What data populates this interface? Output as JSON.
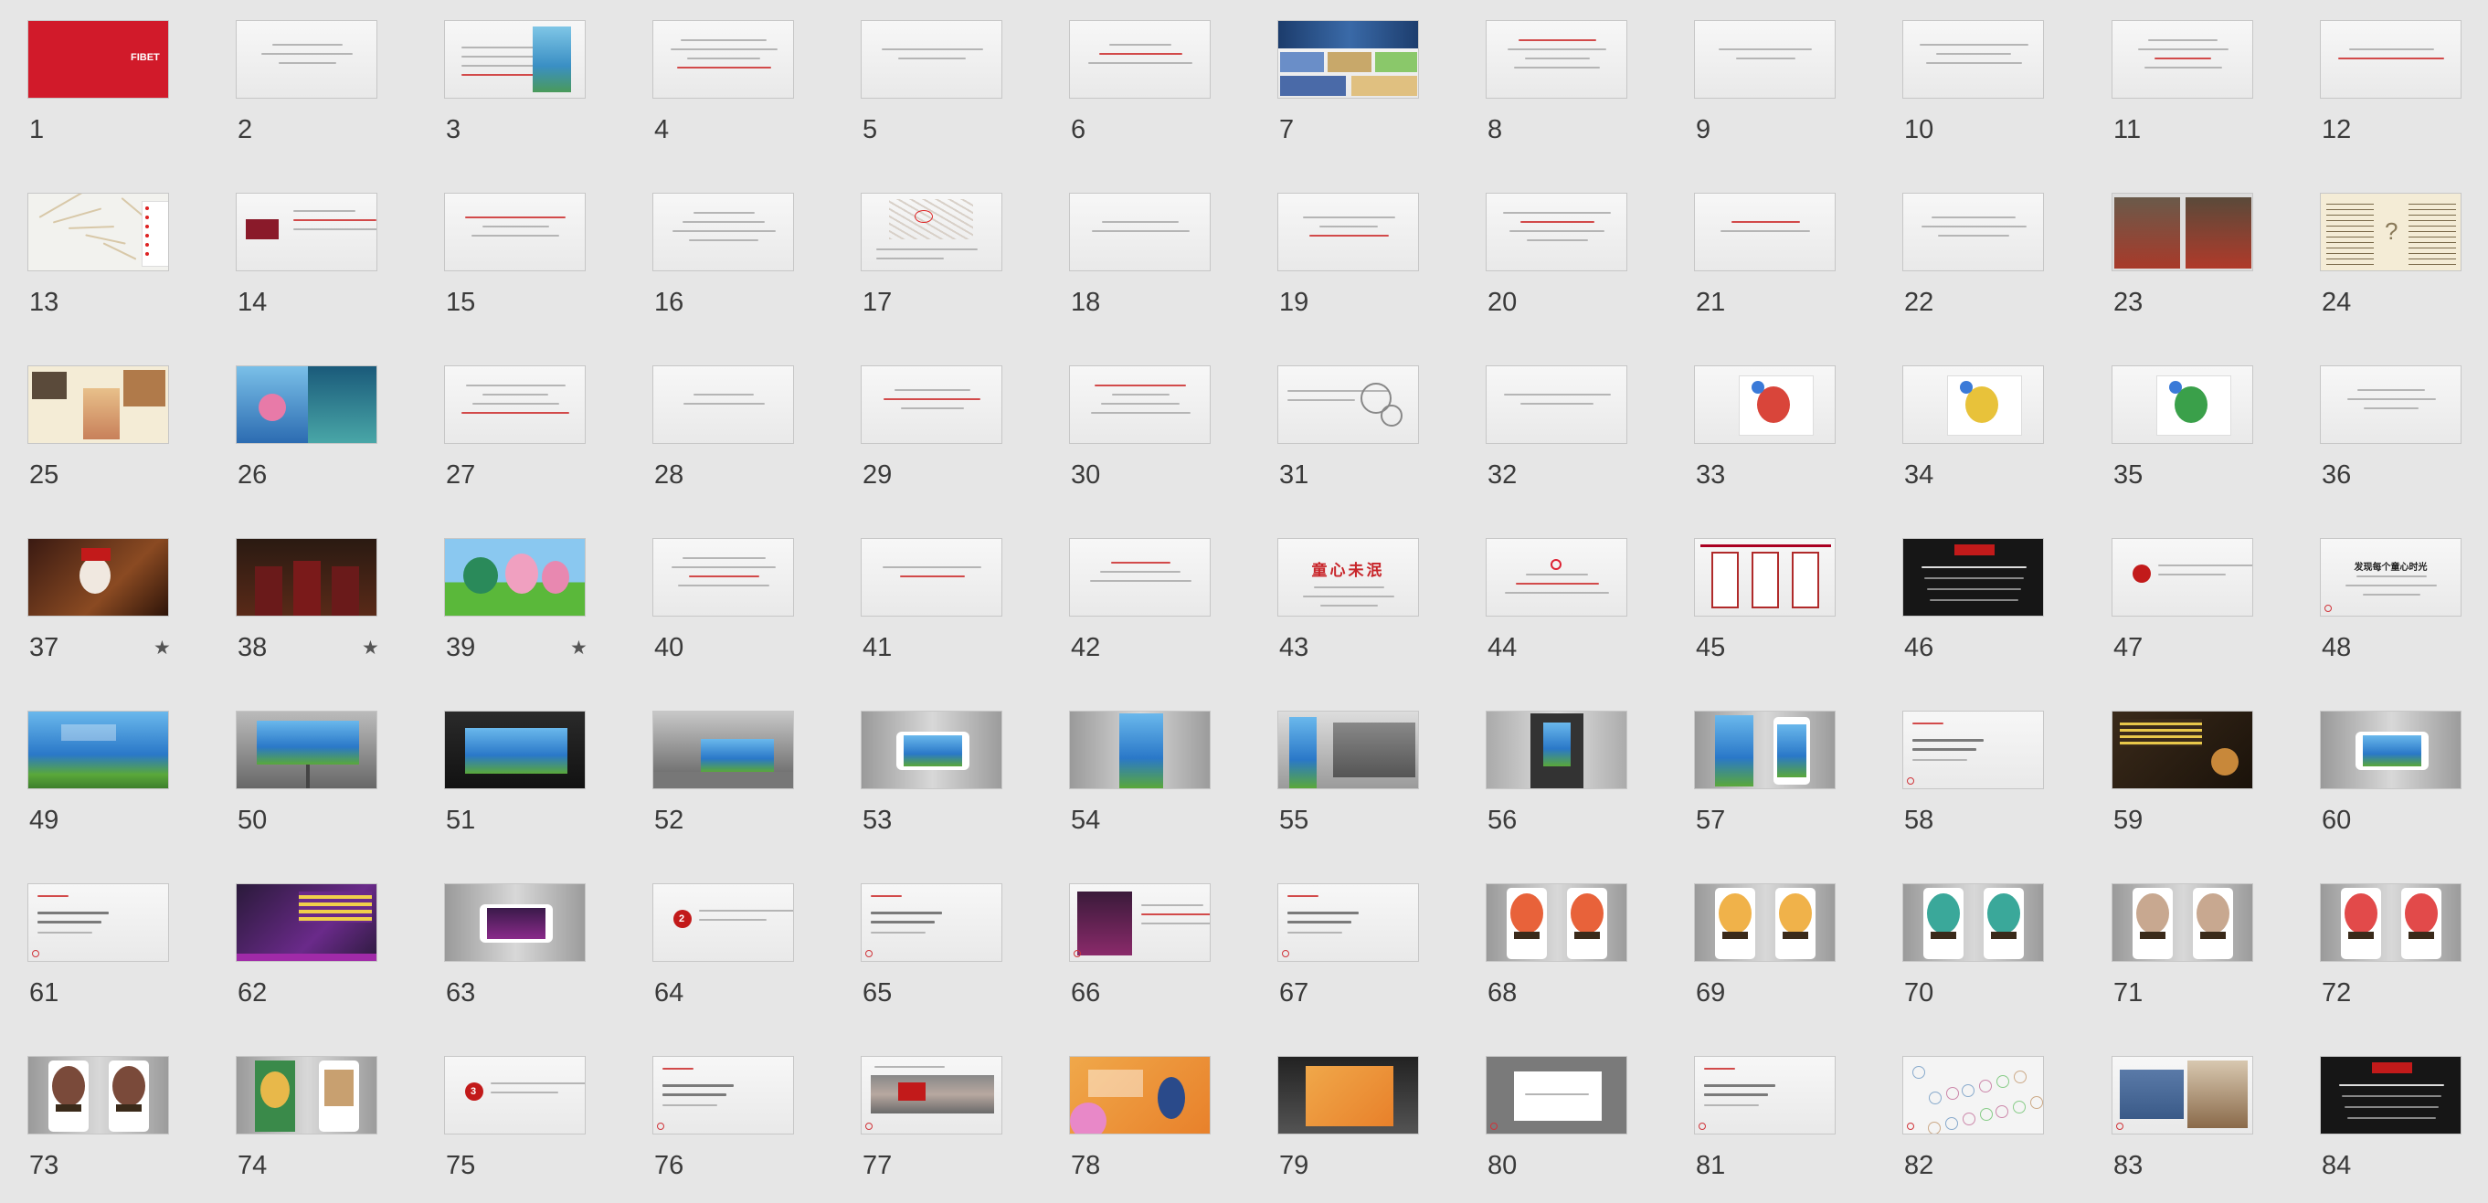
{
  "app": "Slide Sorter",
  "slides": [
    {
      "n": "1",
      "t": "red",
      "logo": "FIBET"
    },
    {
      "n": "2",
      "t": "text",
      "r": 1
    },
    {
      "n": "3",
      "t": "poster"
    },
    {
      "n": "4",
      "t": "text",
      "r": 2
    },
    {
      "n": "5",
      "t": "text",
      "r": 3
    },
    {
      "n": "6",
      "t": "text",
      "r": 4
    },
    {
      "n": "7",
      "t": "collage"
    },
    {
      "n": "8",
      "t": "text",
      "r": 5
    },
    {
      "n": "9",
      "t": "text",
      "r": 6
    },
    {
      "n": "10",
      "t": "text",
      "r": 7
    },
    {
      "n": "11",
      "t": "text",
      "r": 8
    },
    {
      "n": "12",
      "t": "text",
      "r": 9
    },
    {
      "n": "13",
      "t": "map"
    },
    {
      "n": "14",
      "t": "info"
    },
    {
      "n": "15",
      "t": "text",
      "r": 10
    },
    {
      "n": "16",
      "t": "text",
      "r": 11
    },
    {
      "n": "17",
      "t": "sketch"
    },
    {
      "n": "18",
      "t": "text",
      "r": 12
    },
    {
      "n": "19",
      "t": "text",
      "r": 13
    },
    {
      "n": "20",
      "t": "text",
      "r": 14
    },
    {
      "n": "21",
      "t": "text",
      "r": 15
    },
    {
      "n": "22",
      "t": "text",
      "r": 16
    },
    {
      "n": "23",
      "t": "photos"
    },
    {
      "n": "24",
      "t": "cream"
    },
    {
      "n": "25",
      "t": "cream2"
    },
    {
      "n": "26",
      "t": "kids"
    },
    {
      "n": "27",
      "t": "text",
      "r": 17
    },
    {
      "n": "28",
      "t": "text",
      "r": 18
    },
    {
      "n": "29",
      "t": "text",
      "r": 19
    },
    {
      "n": "30",
      "t": "text",
      "r": 20
    },
    {
      "n": "31",
      "t": "linedraw"
    },
    {
      "n": "32",
      "t": "text",
      "r": 21
    },
    {
      "n": "33",
      "t": "drawing",
      "c": "#d9453a"
    },
    {
      "n": "34",
      "t": "drawing",
      "c": "#e8c23a"
    },
    {
      "n": "35",
      "t": "drawing",
      "c": "#3aa04a"
    },
    {
      "n": "36",
      "t": "text",
      "r": 22
    },
    {
      "n": "37",
      "t": "santa",
      "star": true
    },
    {
      "n": "38",
      "t": "wizard",
      "star": true
    },
    {
      "n": "39",
      "t": "cartoon",
      "star": true
    },
    {
      "n": "40",
      "t": "text",
      "r": 23
    },
    {
      "n": "41",
      "t": "text",
      "r": 24
    },
    {
      "n": "42",
      "t": "text",
      "r": 25
    },
    {
      "n": "43",
      "t": "title",
      "title": "童心未泯",
      "tc": "#c8252a"
    },
    {
      "n": "44",
      "t": "title2"
    },
    {
      "n": "45",
      "t": "frames"
    },
    {
      "n": "46",
      "t": "darktitle"
    },
    {
      "n": "47",
      "t": "reddot",
      "dot": ""
    },
    {
      "n": "48",
      "t": "title3",
      "title": "发现每个童心时光"
    },
    {
      "n": "49",
      "t": "billboard"
    },
    {
      "n": "50",
      "t": "bbgray"
    },
    {
      "n": "51",
      "t": "bbdark"
    },
    {
      "n": "52",
      "t": "bbstreet"
    },
    {
      "n": "53",
      "t": "phone"
    },
    {
      "n": "54",
      "t": "lightbox"
    },
    {
      "n": "55",
      "t": "station"
    },
    {
      "n": "56",
      "t": "elevator"
    },
    {
      "n": "57",
      "t": "twoad"
    },
    {
      "n": "58",
      "t": "redtext"
    },
    {
      "n": "59",
      "t": "dark"
    },
    {
      "n": "60",
      "t": "phone"
    },
    {
      "n": "61",
      "t": "redtext"
    },
    {
      "n": "62",
      "t": "purple"
    },
    {
      "n": "63",
      "t": "phone2"
    },
    {
      "n": "64",
      "t": "reddot",
      "dot": "2"
    },
    {
      "n": "65",
      "t": "redtext"
    },
    {
      "n": "66",
      "t": "adtext"
    },
    {
      "n": "67",
      "t": "redtext"
    },
    {
      "n": "68",
      "t": "faces",
      "c": "#e8623a"
    },
    {
      "n": "69",
      "t": "faces",
      "c": "#f0b24a"
    },
    {
      "n": "70",
      "t": "faces",
      "c": "#3aa89a"
    },
    {
      "n": "71",
      "t": "faces",
      "c": "#c8a890"
    },
    {
      "n": "72",
      "t": "faces",
      "c": "#e24a4a"
    },
    {
      "n": "73",
      "t": "faces",
      "c": "#7a4a3a"
    },
    {
      "n": "74",
      "t": "faces2"
    },
    {
      "n": "75",
      "t": "reddot",
      "dot": "3"
    },
    {
      "n": "76",
      "t": "redtext"
    },
    {
      "n": "77",
      "t": "street"
    },
    {
      "n": "78",
      "t": "orange"
    },
    {
      "n": "79",
      "t": "orangebb"
    },
    {
      "n": "80",
      "t": "graybox"
    },
    {
      "n": "81",
      "t": "redtext"
    },
    {
      "n": "82",
      "t": "diagram"
    },
    {
      "n": "83",
      "t": "photos2"
    },
    {
      "n": "84",
      "t": "darktitle"
    }
  ]
}
